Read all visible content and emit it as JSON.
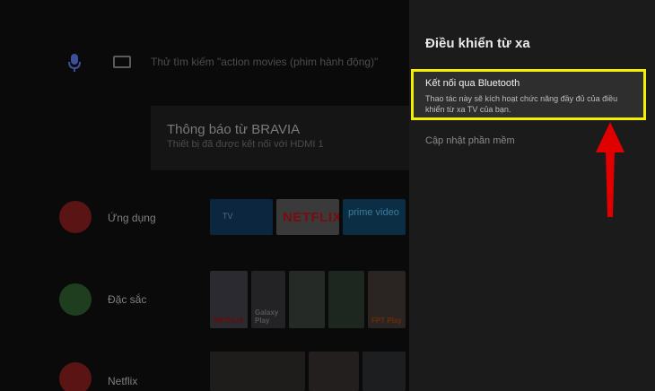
{
  "search": {
    "hint": "Thử tìm kiếm \"action movies (phim hành động)\""
  },
  "notification": {
    "title": "Thông báo từ BRAVIA",
    "subtitle": "Thiết bị đã được kết nối với HDMI 1"
  },
  "rows": [
    {
      "label": "Ứng dụng",
      "color": "#c62828"
    },
    {
      "label": "Đặc sắc",
      "color": "#43a047"
    },
    {
      "label": "Netflix",
      "color": "#c62828"
    }
  ],
  "app_tiles": {
    "tv": "TV",
    "netflix": "NETFLIX",
    "prime": "prime video"
  },
  "poster_labels": {
    "netflix": "NETFLIX",
    "galaxy": "Galaxy Play",
    "fpt": "FPT Play"
  },
  "panel": {
    "title": "Điều khiển từ xa",
    "items": [
      {
        "title": "Kết nối qua Bluetooth",
        "description": "Thao tác này sẽ kích hoạt chức năng đầy đủ của điều khiển từ xa TV của bạn."
      },
      {
        "title": "Cập nhật phần mềm"
      }
    ]
  },
  "colors": {
    "highlight": "#f4ef00",
    "arrow": "#e00000"
  }
}
